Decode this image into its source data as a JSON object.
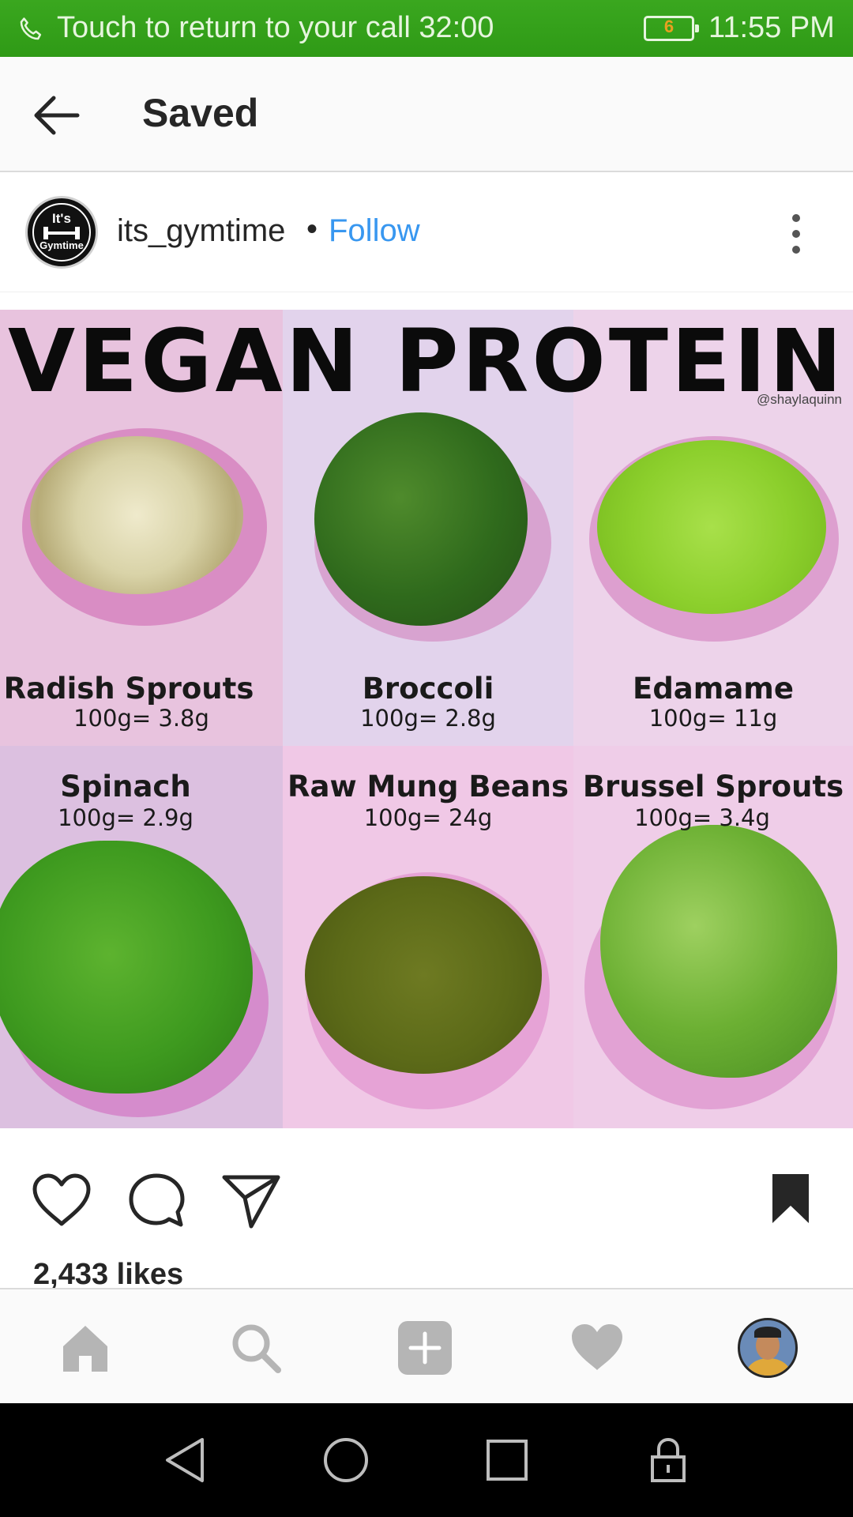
{
  "status_bar": {
    "call_text": "Touch to return to your call",
    "call_timer": "32:00",
    "battery_level": "6",
    "time": "11:55 PM",
    "background_color": "#34a01a"
  },
  "header": {
    "title": "Saved"
  },
  "post": {
    "avatar_text_top": "It's",
    "avatar_text_bottom": "Gymtime",
    "username": "its_gymtime",
    "separator": "•",
    "follow_label": "Follow",
    "follow_color": "#3897f0",
    "image": {
      "headline": "VEGAN PROTEIN",
      "credit": "@shaylaquinn",
      "items": [
        {
          "name": "Radish Sprouts",
          "amount": "100g= 3.8g"
        },
        {
          "name": "Broccoli",
          "amount": "100g= 2.8g"
        },
        {
          "name": "Edamame",
          "amount": "100g= 11g"
        },
        {
          "name": "Spinach",
          "amount": "100g= 2.9g"
        },
        {
          "name": "Raw Mung Beans",
          "amount": "100g= 24g"
        },
        {
          "name": "Brussel Sprouts",
          "amount": "100g= 3.4g"
        }
      ]
    },
    "likes": "2,433 likes",
    "saved": true
  },
  "icons": {
    "status": [
      "phone-icon",
      "battery-icon"
    ],
    "header": [
      "back-arrow-icon"
    ],
    "post": [
      "more-options-icon"
    ],
    "actions": [
      "heart-icon",
      "comment-icon",
      "share-icon",
      "bookmark-icon"
    ],
    "bottom_nav": [
      "home-icon",
      "search-icon",
      "add-post-icon",
      "activity-heart-icon",
      "profile-avatar"
    ],
    "system_nav": [
      "back-triangle-icon",
      "home-circle-icon",
      "recents-square-icon",
      "lock-icon"
    ]
  }
}
